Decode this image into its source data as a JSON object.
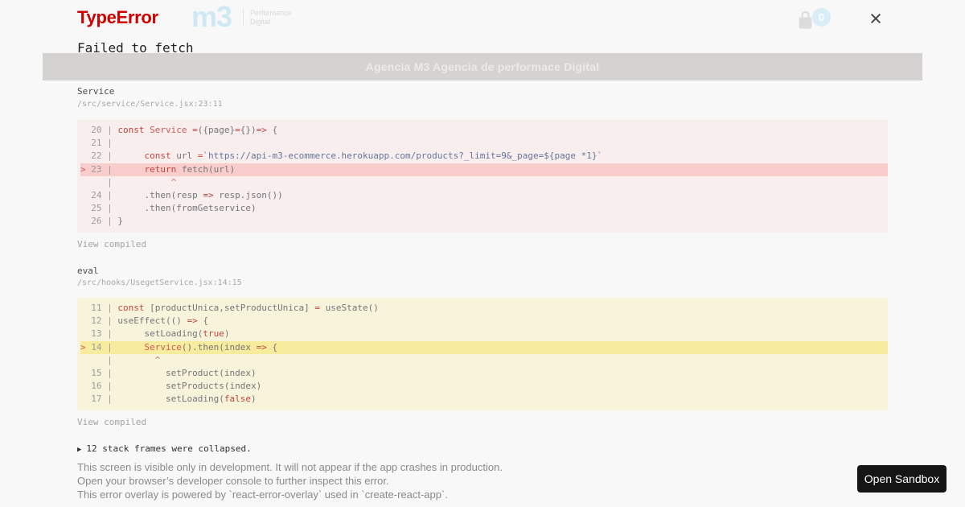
{
  "app": {
    "logo": {
      "mark": "m3",
      "tag_line1": "Performance",
      "tag_line2": "Digital"
    },
    "cart_count": "0",
    "banner": "Agencia M3 Agencia de performace Digital"
  },
  "overlay": {
    "title": "TypeError",
    "message": "Failed to fetch",
    "close_label": "×",
    "frames": [
      {
        "fn": "Service",
        "path": "/src/service/Service.jsx:23:11",
        "variant": "error",
        "view_compiled": "View compiled",
        "lines": [
          {
            "n": "20",
            "ind": 0,
            "segs": [
              {
                "t": "const",
                "c": "k"
              },
              {
                "t": " ",
                "c": "d"
              },
              {
                "t": "Service",
                "c": "r"
              },
              {
                "t": " ",
                "c": "d"
              },
              {
                "t": "=",
                "c": "k"
              },
              {
                "t": "({page}",
                "c": "d"
              },
              {
                "t": "=",
                "c": "k"
              },
              {
                "t": "{})",
                "c": "d"
              },
              {
                "t": "=>",
                "c": "k"
              },
              {
                "t": " {",
                "c": "d"
              }
            ]
          },
          {
            "n": "21",
            "ind": 0,
            "segs": []
          },
          {
            "n": "22",
            "ind": 5,
            "segs": [
              {
                "t": "const",
                "c": "k"
              },
              {
                "t": " url ",
                "c": "d"
              },
              {
                "t": "=",
                "c": "k"
              },
              {
                "t": "`https://api-m3-ecommerce.herokuapp.com/products?_limit=9&_page=${page *1}`",
                "c": "s"
              }
            ]
          },
          {
            "n": "23",
            "m": ">",
            "hl": true,
            "ind": 5,
            "segs": [
              {
                "t": "return",
                "c": "k"
              },
              {
                "t": " fetch(url)",
                "c": "d"
              }
            ]
          },
          {
            "caret": 10
          },
          {
            "n": "24",
            "ind": 5,
            "segs": [
              {
                "t": ".then(resp ",
                "c": "d"
              },
              {
                "t": "=>",
                "c": "k"
              },
              {
                "t": " resp.json())",
                "c": "d"
              }
            ]
          },
          {
            "n": "25",
            "ind": 5,
            "segs": [
              {
                "t": ".then(fromGetservice)",
                "c": "d"
              }
            ]
          },
          {
            "n": "26",
            "ind": 0,
            "segs": [
              {
                "t": "}",
                "c": "d"
              }
            ]
          }
        ]
      },
      {
        "fn": "eval",
        "path": "/src/hooks/UsegetService.jsx:14:15",
        "variant": "warning",
        "view_compiled": "View compiled",
        "lines": [
          {
            "n": "11",
            "ind": 0,
            "segs": [
              {
                "t": "const",
                "c": "k"
              },
              {
                "t": " [productUnica,setProductUnica] ",
                "c": "d"
              },
              {
                "t": "=",
                "c": "k"
              },
              {
                "t": " useState()",
                "c": "d"
              }
            ]
          },
          {
            "n": "12",
            "ind": 0,
            "segs": [
              {
                "t": "useEffect(() ",
                "c": "d"
              },
              {
                "t": "=>",
                "c": "k"
              },
              {
                "t": " {",
                "c": "d"
              }
            ]
          },
          {
            "n": "13",
            "ind": 5,
            "segs": [
              {
                "t": "setLoading(",
                "c": "d"
              },
              {
                "t": "true",
                "c": "k"
              },
              {
                "t": ")",
                "c": "d"
              }
            ]
          },
          {
            "n": "14",
            "m": ">",
            "hl": true,
            "ind": 5,
            "segs": [
              {
                "t": "Service",
                "c": "r"
              },
              {
                "t": "().then(index ",
                "c": "d"
              },
              {
                "t": "=>",
                "c": "k"
              },
              {
                "t": " {",
                "c": "d"
              }
            ]
          },
          {
            "caret": 7
          },
          {
            "n": "15",
            "ind": 9,
            "segs": [
              {
                "t": "setProduct(index)",
                "c": "d"
              }
            ]
          },
          {
            "n": "16",
            "ind": 9,
            "segs": [
              {
                "t": "setProducts(index)",
                "c": "d"
              }
            ]
          },
          {
            "n": "17",
            "ind": 9,
            "segs": [
              {
                "t": "setLoading(",
                "c": "d"
              },
              {
                "t": "false",
                "c": "k"
              },
              {
                "t": ")",
                "c": "d"
              }
            ]
          }
        ]
      }
    ],
    "collapse_arrow": "▶",
    "collapsed_text": "12 stack frames were collapsed.",
    "footer": [
      "This screen is visible only in development. It will not appear if the app crashes in production.",
      "Open your browser’s developer console to further inspect this error.",
      "This error overlay is powered by `react-error-overlay` used in `create-react-app`."
    ]
  },
  "sandbox_button": "Open Sandbox",
  "colors": {
    "error_accent": "#ce0000",
    "keyword_red": "#c5443e",
    "name_red": "#cd5a55",
    "string_blue": "#64749b",
    "error_frame_bg": "#f8eeee",
    "error_line_bg": "#f8cdcb",
    "warning_frame_bg": "#f8f4dc",
    "warning_line_bg": "#f7eb9e",
    "brand_blue": "#cfe9f4",
    "sandbox_button_bg": "#151515"
  }
}
